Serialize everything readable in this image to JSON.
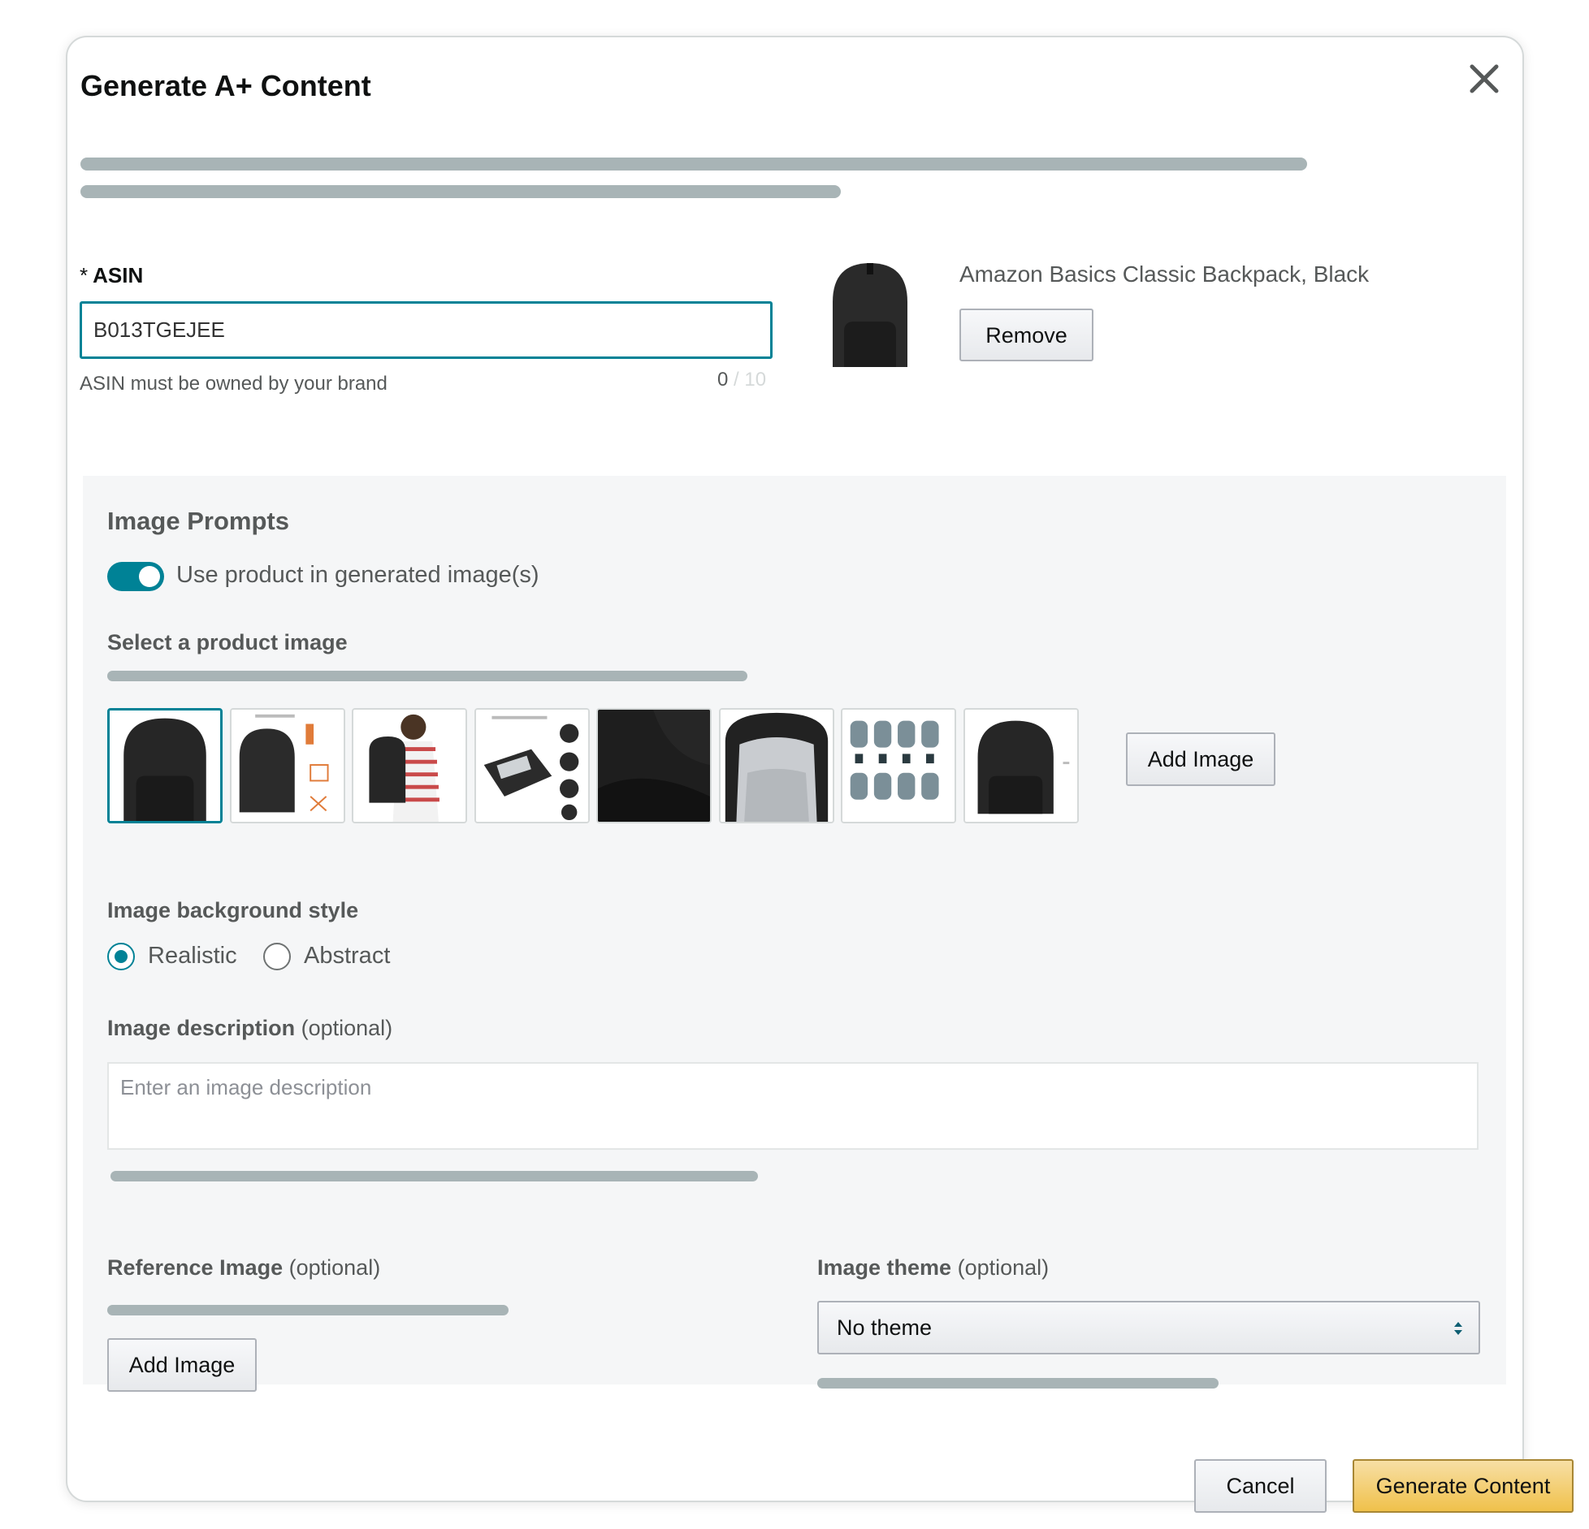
{
  "dialog": {
    "title": "Generate A+ Content",
    "close_icon": "close-icon"
  },
  "asin": {
    "required_marker": "*",
    "label": "ASIN",
    "value": "B013TGEJEE",
    "hint": "ASIN must be owned by your brand",
    "count_current": "0",
    "count_max": " / 10"
  },
  "product": {
    "name": "Amazon Basics Classic Backpack, Black",
    "remove_label": "Remove"
  },
  "image_prompts": {
    "title": "Image Prompts",
    "use_product_toggle": {
      "label": "Use product in generated image(s)",
      "on": true
    },
    "select_product_image_label": "Select a product image",
    "product_images": [
      {
        "icon": "backpack-front-thumbnail",
        "selected": true
      },
      {
        "icon": "backpack-infographic-thumbnail",
        "selected": false
      },
      {
        "icon": "backpack-worn-thumbnail",
        "selected": false
      },
      {
        "icon": "backpack-features-thumbnail",
        "selected": false
      },
      {
        "icon": "backpack-closeup-thumbnail",
        "selected": false
      },
      {
        "icon": "backpack-open-thumbnail",
        "selected": false
      },
      {
        "icon": "backpack-colors-thumbnail",
        "selected": false
      },
      {
        "icon": "backpack-side-thumbnail",
        "selected": false
      }
    ],
    "add_image_label": "Add Image",
    "background_style": {
      "label": "Image background style",
      "options": [
        "Realistic",
        "Abstract"
      ],
      "selected": "Realistic"
    },
    "description": {
      "label": "Image description",
      "optional": "(optional)",
      "placeholder": "Enter an image description",
      "value": ""
    },
    "reference_image": {
      "label": "Reference Image",
      "optional": "(optional)",
      "add_image_label": "Add Image"
    },
    "theme": {
      "label": "Image theme",
      "optional": "(optional)",
      "selected": "No theme"
    }
  },
  "footer": {
    "cancel_label": "Cancel",
    "generate_label": "Generate Content"
  },
  "colors": {
    "accent_teal": "#008296",
    "primary_button": "#f0c14b",
    "skeleton": "#a8b4b6",
    "panel_bg": "#f5f6f7"
  }
}
